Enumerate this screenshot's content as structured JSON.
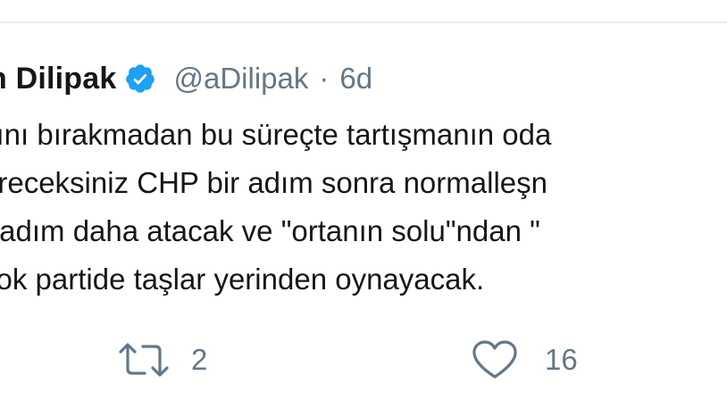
{
  "tweet": {
    "author_name": "n Dilipak",
    "handle": "@aDilipak",
    "separator": "·",
    "timestamp": "6d",
    "lines": [
      "sını bırakmadan bu süreçte tartışmanın oda",
      "öreceksiniz CHP bir adım sonra normalleşn",
      "r adım daha atacak ve \"ortanın solu\"ndan \"",
      "çok partide taşlar yerinden oynayacak."
    ]
  },
  "actions": {
    "retweet_count": "2",
    "like_count": "16"
  },
  "icons": {
    "verified": "verified-badge-icon",
    "retweet": "retweet-icon",
    "like": "heart-icon"
  },
  "colors": {
    "verified_blue": "#1da1f2",
    "text_primary": "#14171a",
    "text_secondary": "#657786",
    "divider": "#e6ecf0"
  }
}
